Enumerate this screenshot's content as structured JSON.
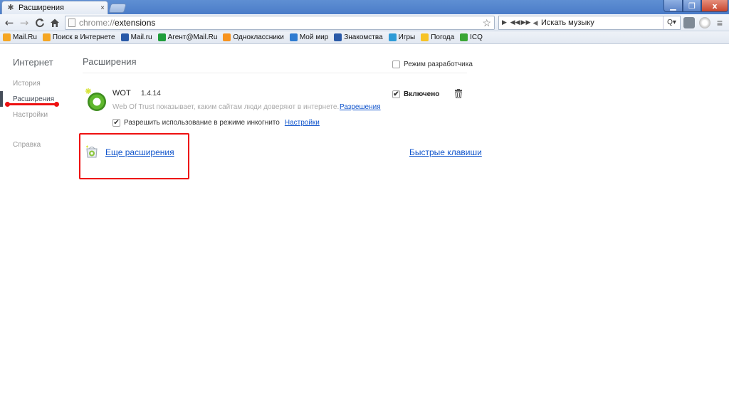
{
  "tab": {
    "title": "Расширения",
    "icon": "puzzle-icon",
    "close": "×"
  },
  "window_controls": {
    "minimize": "▁",
    "maximize": "❐",
    "close": "x"
  },
  "toolbar": {
    "back": "←",
    "forward": "→",
    "reload": "C",
    "home": "⌂",
    "url_scheme": "chrome://",
    "url_path": "extensions",
    "star": "☆",
    "player": {
      "prev": "◀◀",
      "play": "▶",
      "next": "▶▶",
      "search_placeholder": "Искать музыку",
      "search_btn": "Q▾"
    }
  },
  "bookmarks": [
    {
      "label": "Mail.Ru",
      "icon": "mailru-icon",
      "color": "#f5a623"
    },
    {
      "label": "Поиск в Интернете",
      "icon": "search-icon",
      "color": "#f5a623"
    },
    {
      "label": "Mail.ru",
      "icon": "mailru-icon",
      "color": "#2a5aa8"
    },
    {
      "label": "Агент@Mail.Ru",
      "icon": "agent-icon",
      "color": "#1f9d3b"
    },
    {
      "label": "Одноклассники",
      "icon": "odnoklassniki-icon",
      "color": "#f7931e"
    },
    {
      "label": "Мой мир",
      "icon": "moy-mir-icon",
      "color": "#2e7bd1"
    },
    {
      "label": "Знакомства",
      "icon": "dating-icon",
      "color": "#2a5aa8"
    },
    {
      "label": "Игры",
      "icon": "games-icon",
      "color": "#2e9bd6"
    },
    {
      "label": "Погода",
      "icon": "weather-icon",
      "color": "#f7c325"
    },
    {
      "label": "ICQ",
      "icon": "icq-icon",
      "color": "#3aa635"
    }
  ],
  "sidebar": {
    "title": "Интернет",
    "items": [
      {
        "label": "История"
      },
      {
        "label": "Расширения"
      },
      {
        "label": "Настройки"
      },
      {
        "label": "Справка"
      }
    ],
    "selected": "Расширения"
  },
  "main": {
    "title": "Расширения",
    "dev_mode_label": "Режим разработчика",
    "dev_mode_checked": false,
    "extension": {
      "name": "WOT",
      "version": "1.4.14",
      "description": "Web Of Trust показывает, каким сайтам люди доверяют в интернете.",
      "permissions_link": "Разрешения",
      "incognito_label": "Разрешить использование в режиме инкогнито",
      "incognito_checked": true,
      "options_link": "Настройки",
      "enabled_label": "Включено",
      "enabled_checked": true
    },
    "more_extensions_link": "Еще расширения",
    "shortcuts_link": "Быстрые клавиши"
  },
  "annotations": {
    "highlight_color": "#ee1111"
  }
}
